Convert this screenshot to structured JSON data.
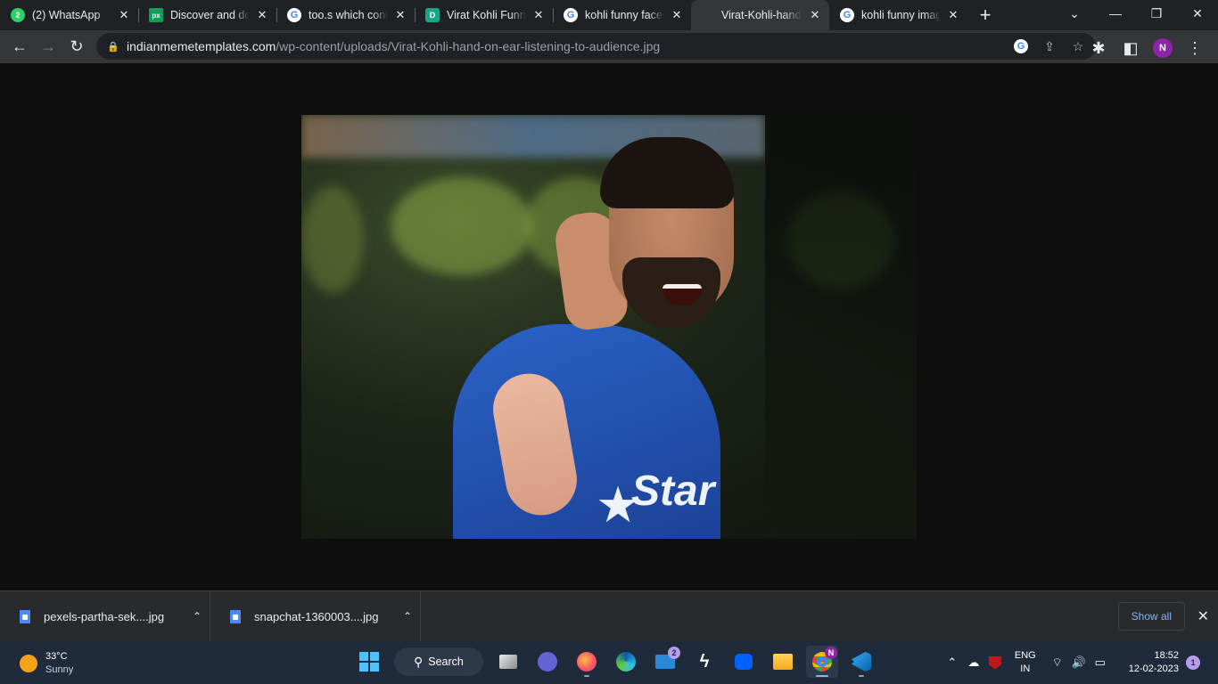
{
  "browser": {
    "tabs": [
      {
        "title": "(2) WhatsApp",
        "favicon": "whatsapp-icon",
        "badge": "2"
      },
      {
        "title": "Discover and dow",
        "favicon": "pixabay-icon",
        "badge": "px"
      },
      {
        "title": "too.s which conta",
        "favicon": "google-icon",
        "badge": "G"
      },
      {
        "title": "Virat Kohli Funny",
        "favicon": "site-icon",
        "badge": "D"
      },
      {
        "title": "kohli funny faces",
        "favicon": "google-icon",
        "badge": "G"
      },
      {
        "title": "Virat-Kohli-hand-",
        "favicon": "none",
        "badge": "",
        "active": true
      },
      {
        "title": "kohli funny imag",
        "favicon": "google-icon",
        "badge": "G"
      }
    ],
    "close_glyph": "✕",
    "new_tab_glyph": "+",
    "window": {
      "menu": "⌄",
      "minimize": "—",
      "restore": "❐",
      "close": "✕"
    },
    "toolbar": {
      "back": "←",
      "forward": "→",
      "reload": "↻",
      "lock": "🔒",
      "url_host": "indianmemetemplates.com",
      "url_path": "/wp-content/uploads/Virat-Kohli-hand-on-ear-listening-to-audience.jpg",
      "google_badge": "G",
      "share": "⇪",
      "bookmark": "☆",
      "extensions": "✱",
      "sidepanel": "◧",
      "profile_initial": "N",
      "menu": "⋮"
    }
  },
  "image": {
    "sponsor_text": "Star",
    "star_glyph": "★"
  },
  "downloads": {
    "items": [
      {
        "name": "pexels-partha-sek....jpg"
      },
      {
        "name": "snapchat-1360003....jpg"
      }
    ],
    "caret": "⌃",
    "show_all": "Show all",
    "close": "✕"
  },
  "taskbar": {
    "weather": {
      "temp": "33°C",
      "condition": "Sunny"
    },
    "search_label": "Search",
    "search_glyph": "⚲",
    "mail_badge": "2",
    "chrome_badge": "N",
    "tray": {
      "chevron": "⌃",
      "cloud": "☁",
      "wifi": "⌔",
      "volume": "🔊",
      "battery": "▭"
    },
    "lang": {
      "line1": "ENG",
      "line2": "IN"
    },
    "clock": {
      "time": "18:52",
      "date": "12-02-2023"
    },
    "notifications": "1"
  }
}
